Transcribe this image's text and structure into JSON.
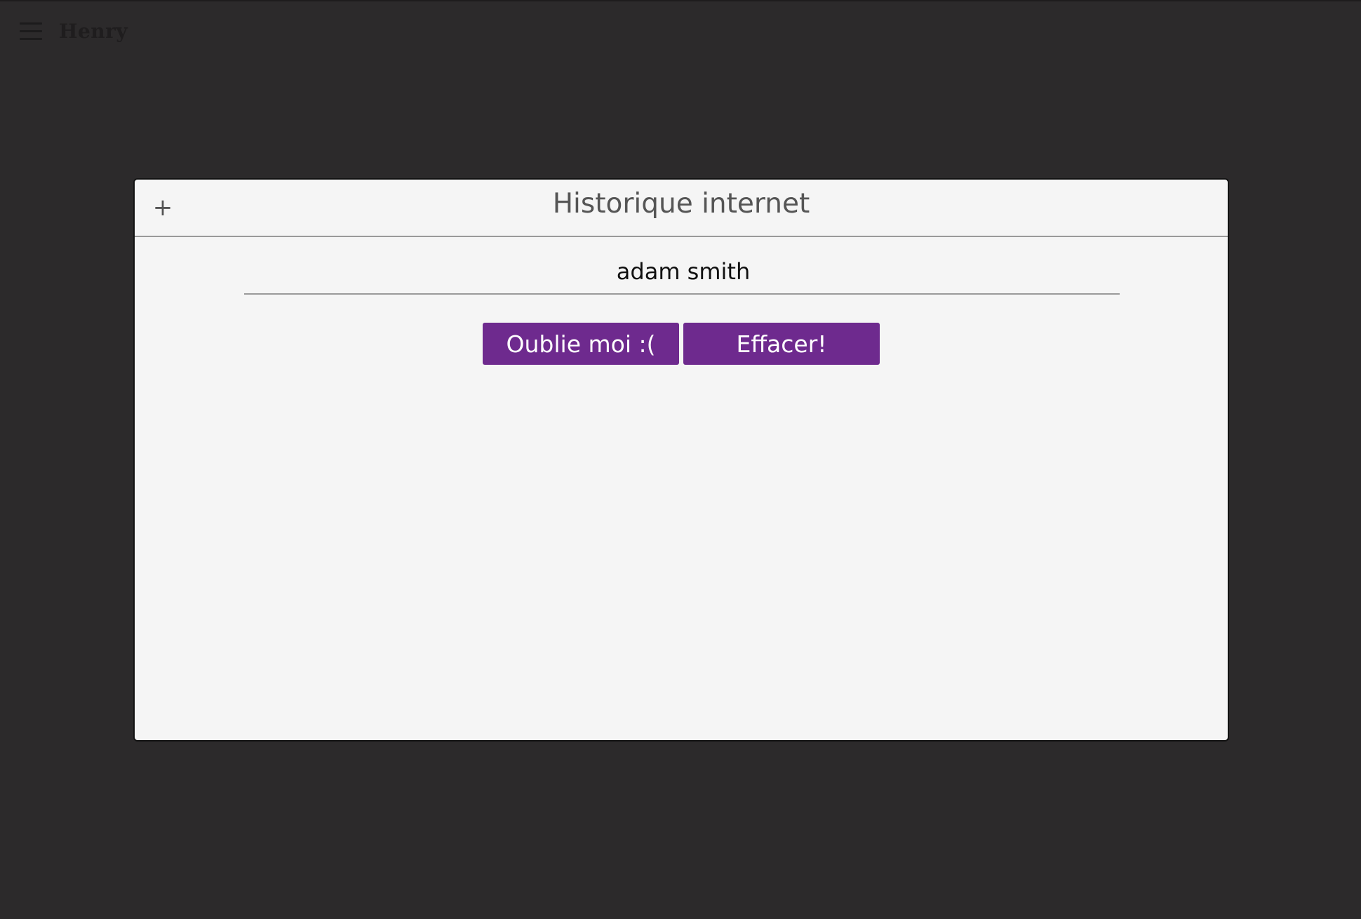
{
  "app": {
    "brand": "Henry"
  },
  "window": {
    "title": "Historique internet",
    "search": {
      "value": "adam smith"
    },
    "buttons": {
      "forget": "Oublie moi :(",
      "erase": "Effacer!"
    }
  },
  "colors": {
    "background": "#2c2a2b",
    "panel": "#f5f5f5",
    "accent": "#6e2a8e"
  },
  "icons": {
    "menu": "hamburger-menu-icon",
    "add": "plus-icon"
  }
}
